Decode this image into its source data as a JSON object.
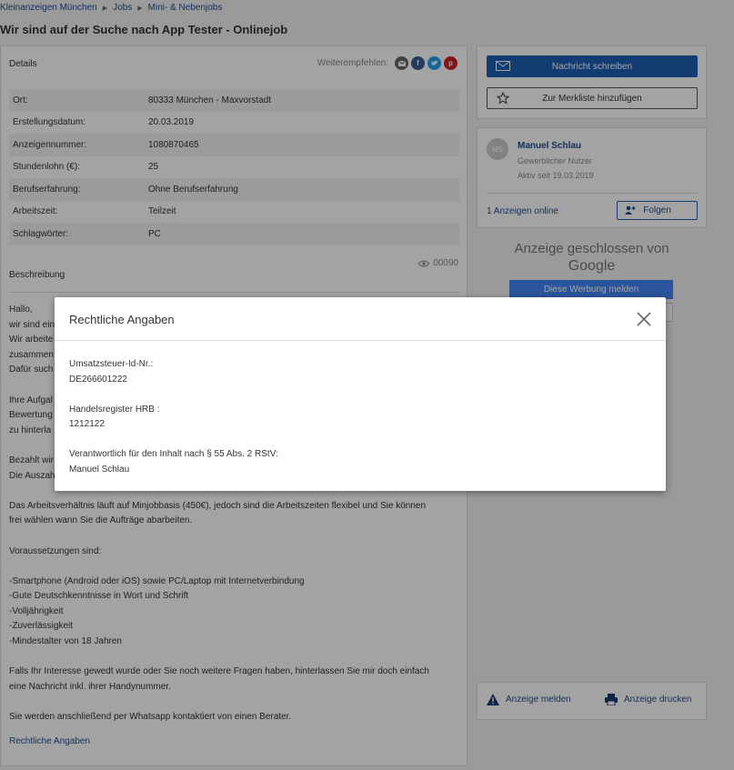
{
  "breadcrumb": [
    "Kleinanzeigen München",
    "Jobs",
    "Mini- & Nebenjobs"
  ],
  "title": "Wir sind auf der Suche nach App Tester - Onlinejob",
  "details": {
    "heading": "Details",
    "share_label": "Weiterempfehlen:",
    "rows": [
      {
        "key": "Ort:",
        "value": "80333 München - Maxvorstadt"
      },
      {
        "key": "Erstellungsdatum:",
        "value": "20.03.2019"
      },
      {
        "key": "Anzeigennummer:",
        "value": "1080870465"
      },
      {
        "key": "Stundenlohn (€):",
        "value": "25"
      },
      {
        "key": "Berufserfahrung:",
        "value": "Ohne Berufserfahrung"
      },
      {
        "key": "Arbeitszeit:",
        "value": "Teilzeit"
      },
      {
        "key": "Schlagwörter:",
        "value": "PC"
      }
    ],
    "views": "00090"
  },
  "description": {
    "heading": "Beschreibung",
    "paragraphs": [
      "Hallo,\nwir sind ein\nWir arbeite\nzusammen\nDafür such",
      "Ihre Aufgal\nBewertung\nzu hinterla",
      "Bezahlt wir\nDie Auszah",
      "Das Arbeitsverhältnis läuft auf Minjobbasis (450€), jedoch sind die Arbeitszeiten flexibel und Sie können\nfrei wählen wann Sie die Aufträge abarbeiten.",
      "Voraussetzungen sind:",
      "-Smartphone (Android oder iOS) sowie PC/Laptop mit Internetverbindung\n-Gute Deutschkenntnisse in Wort und Schrift\n-Volljährigkeit\n-Zuverlässigkeit\n-Mindestalter von 18 Jahren",
      "Falls Ihr Interesse gewedt wurde oder Sie noch weitere Fragen haben, hinterlassen Sie mir doch einfach\neine Nachricht inkl. ihrer Handynummer.",
      "Sie werden anschließend per Whatsapp kontaktiert von einen Berater."
    ],
    "legal_link": "Rechtliche Angaben"
  },
  "sidebar": {
    "message_button": "Nachricht schreiben",
    "watchlist_button": "Zur Merkliste hinzufügen",
    "user": {
      "initials": "MS",
      "name": "Manuel Schlau",
      "role": "Gewerblicher Nutzer",
      "since": "Aktiv seit 19.03.2019",
      "ads_online": "1 Anzeigen online",
      "follow_button": "Folgen"
    },
    "ad_closed": "Anzeige geschlossen von",
    "ad_provider": "Google",
    "report_ad_button": "Diese Werbung melden",
    "report_listing": "Anzeige melden",
    "print_listing": "Anzeige drucken"
  },
  "modal": {
    "title": "Rechtliche Angaben",
    "items": [
      {
        "label": "Umsatzsteuer-Id-Nr.:",
        "value": "DE266601222"
      },
      {
        "label": "Handelsregister HRB :",
        "value": "1212122"
      },
      {
        "label": "Verantwortlich für den Inhalt nach § 55 Abs. 2 RStV:",
        "value": "Manuel Schlau"
      }
    ]
  },
  "colors": {
    "primary": "#1e5fb3",
    "link": "#1d4b8f",
    "share_email": "#666666",
    "share_facebook": "#3b5998",
    "share_twitter": "#1da1f2",
    "share_pinterest": "#cb2027",
    "google_button": "#4285f4"
  }
}
